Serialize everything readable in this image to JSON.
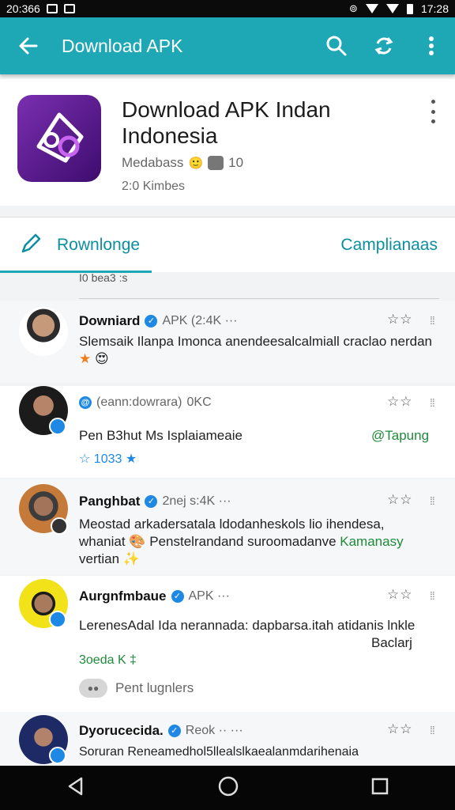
{
  "status_bar": {
    "left_text": "20:366",
    "time": "17:28"
  },
  "app_bar": {
    "title": "Download APK",
    "icons": [
      "back-arrow-icon",
      "search-icon",
      "sync-icon",
      "more-vert-icon"
    ],
    "color": "#1ea7b5"
  },
  "app": {
    "title": "Download APK Indan Indonesia",
    "developer": "Medabass",
    "rating_count": "10",
    "size": "2:0 Kimbes"
  },
  "tabs": {
    "primary": "Rownlonge",
    "secondary": "Camplianaas"
  },
  "section_caption": "I0 bea3 :s",
  "items": [
    {
      "name": "Downiard",
      "meta": "APK (2:4K ···",
      "text": "Slemsaik Ilanpa Imonca anendeesalcalmiall craclao nerdan",
      "stars": "☆☆",
      "drag": "⁞⁞"
    },
    {
      "name": "(eann:dowrara)",
      "meta": "0KC",
      "text": "Pen B3hut Ms Isplaiameaie",
      "link": "@Tapung",
      "footer": "☆ 1033 ★",
      "stars": "☆☆",
      "drag": "⁞⁞"
    },
    {
      "name": "Panghbat",
      "meta": "2nej s:4K ···",
      "text_line1": "Meostad arkadersatala ldodanheskols lio ihendesa,",
      "text_line2_a": "whaniat",
      "text_line2_b": "Penstelrandand suroomadanve",
      "text_line2_green": "Kamanasy",
      "text_line3": "vertian",
      "stars": "☆☆",
      "drag": "⁞⁞"
    },
    {
      "name": "Aurgnfmbaue",
      "meta": "APK ···",
      "text": "LerenesAdal Ida nerannada: dapbarsa.itah atidanis lnkle",
      "right_text": "Baclarj",
      "footer": "3oeda K ‡",
      "chip_label": "Pent lugnlers",
      "stars": "☆☆",
      "drag": "⁞⁞"
    },
    {
      "name": "Dyorucecida.",
      "meta": "Reok ·· ···",
      "text": "Soruran Reneamedhol5llealslkaealanmdarihenaia",
      "stars": "☆☆",
      "drag": "⁞⁞"
    }
  ],
  "nav": {
    "icons": [
      "back-triangle-icon",
      "home-circle-icon",
      "recents-square-icon"
    ]
  }
}
